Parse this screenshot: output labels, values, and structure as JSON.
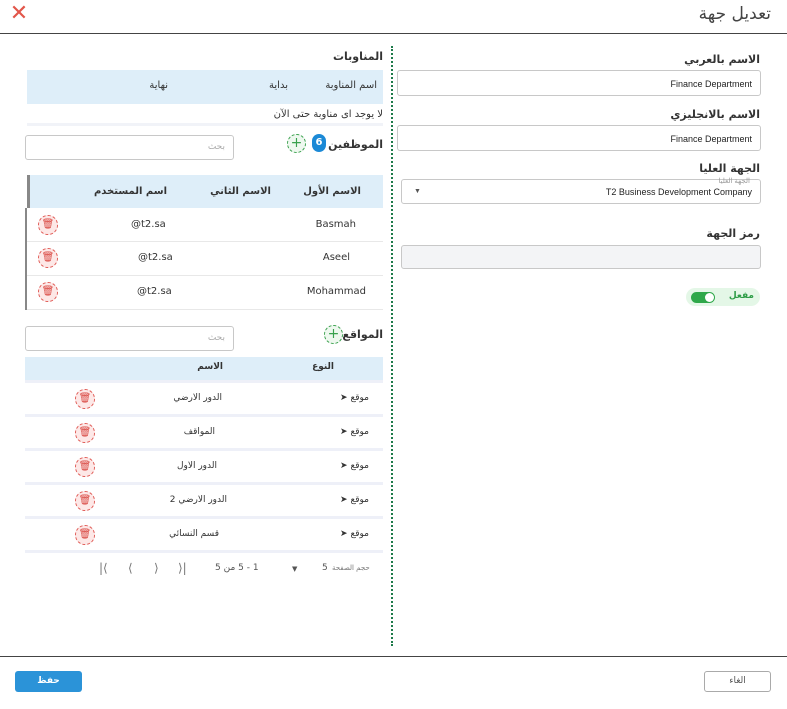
{
  "dialog": {
    "title": "تعديل جهة",
    "close_icon": "close-icon"
  },
  "form": {
    "arabic_name_label": "الاسم بالعربي",
    "arabic_name_value": "Finance Department",
    "english_name_label": "الاسم بالانجليزي",
    "english_name_value": "Finance Department",
    "parent_label": "الجهة العليا",
    "parent_float_label": "الجهة العليا",
    "parent_value": "T2 Business Development Company",
    "code_label": "رمز الجهة",
    "code_value": "",
    "active_label": "مفعل",
    "active": true
  },
  "shifts": {
    "title": "المناوبات",
    "columns": [
      "اسم المناوبة",
      "بداية",
      "نهاية"
    ],
    "empty_text": "لا يوجد اى مناوبة حتى الآن"
  },
  "employees": {
    "title": "الموظفين",
    "count": "6",
    "search_placeholder": "بحث",
    "columns": [
      "الاسم الأول",
      "الاسم الثاني",
      "اسم المستخدم"
    ],
    "rows": [
      {
        "first": "Basmah",
        "second": "",
        "username": "@t2.sa"
      },
      {
        "first": "Aseel",
        "second": "",
        "username": "@t2.sa"
      },
      {
        "first": "Mohammad",
        "second": "",
        "username": "@t2.sa"
      }
    ]
  },
  "locations": {
    "title": "المواقع",
    "search_placeholder": "بحث",
    "columns": [
      "النوع",
      "الاسم"
    ],
    "rows": [
      {
        "type": "موقع",
        "name": "الدور الارضي"
      },
      {
        "type": "موقع",
        "name": "المواقف"
      },
      {
        "type": "موقع",
        "name": "الدور الاول"
      },
      {
        "type": "موقع",
        "name": "الدور الارضي 2"
      },
      {
        "type": "موقع",
        "name": "قسم النسائي"
      }
    ],
    "pagination": {
      "page_size_label": "حجم الصفحة",
      "page_size": "5",
      "range": "1 - 5 من 5"
    }
  },
  "footer": {
    "save_label": "حفظ",
    "cancel_label": "الغاء"
  },
  "colors": {
    "accent": "#2b93d8",
    "active_green": "#2fa84a",
    "danger": "#e05a55",
    "header_bg": "#deeef9"
  }
}
